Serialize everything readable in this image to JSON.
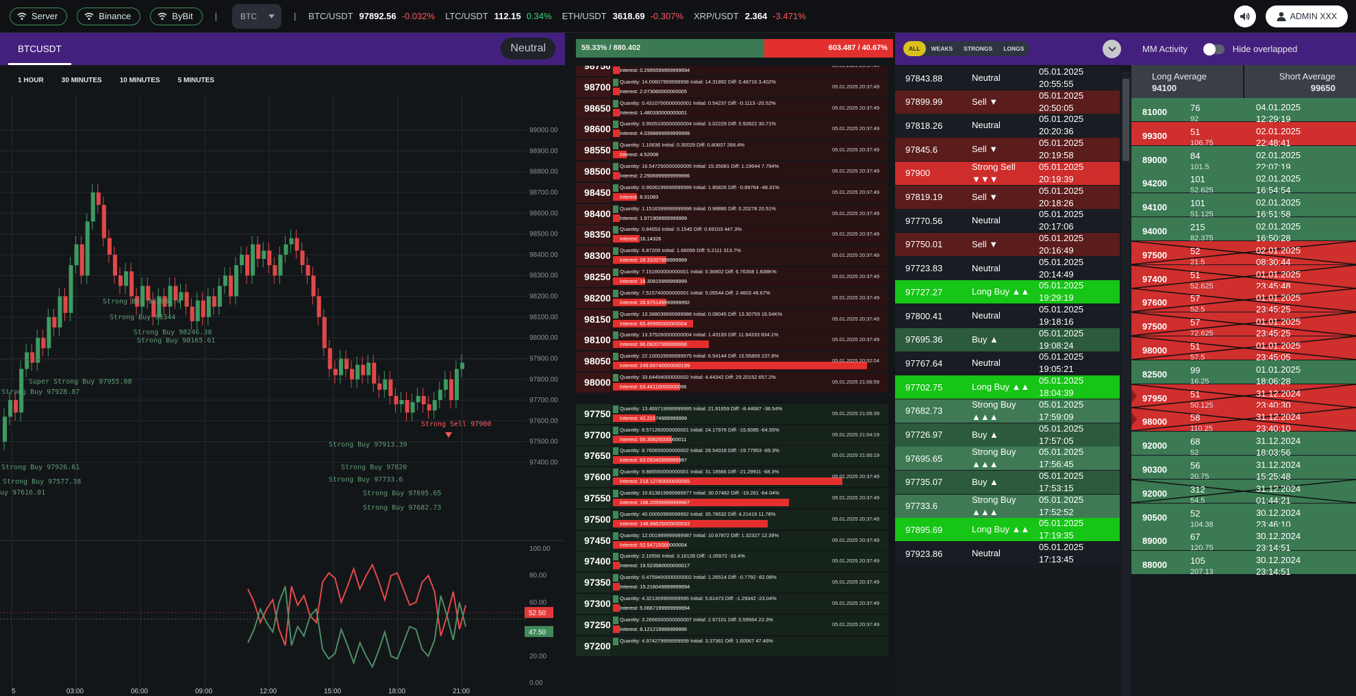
{
  "topbar": {
    "filters": [
      {
        "label": "Server",
        "icon": "wifi-icon"
      },
      {
        "label": "Binance",
        "icon": "wifi-icon"
      },
      {
        "label": "ByBit",
        "icon": "wifi-icon"
      }
    ],
    "separator": "|",
    "coin_select": "BTC",
    "tickers": [
      {
        "symbol": "BTC/USDT",
        "price": "97892.56",
        "change": "-0.032%",
        "dir": "neg"
      },
      {
        "symbol": "LTC/USDT",
        "price": "112.15",
        "change": "0.34%",
        "dir": "pos"
      },
      {
        "symbol": "ETH/USDT",
        "price": "3618.69",
        "change": "-0.307%",
        "dir": "neg"
      },
      {
        "symbol": "XRP/USDT",
        "price": "2.364",
        "change": "-3.471%",
        "dir": "neg"
      }
    ],
    "admin_label": "ADMIN XXX"
  },
  "chart": {
    "symbol_tab": "BTCUSDT",
    "sentiment": "Neutral",
    "timeframes": [
      "1 HOUR",
      "30 MINUTES",
      "10 MINUTES",
      "5 MINUTES"
    ]
  },
  "chart_data": {
    "type": "candlestick",
    "price_axis": [
      "99000.00",
      "98900.00",
      "98800.00",
      "98700.00",
      "98600.00",
      "98500.00",
      "98400.00",
      "98300.00",
      "98200.00",
      "98100.00",
      "98000.00",
      "97900.00",
      "97800.00",
      "97700.00",
      "97600.00",
      "97500.00",
      "97400.00"
    ],
    "ylim": [
      97400,
      99000
    ],
    "x_ticks": [
      "5",
      "03:00",
      "06:00",
      "09:00",
      "12:00",
      "15:00",
      "18:00",
      "21:00"
    ],
    "signal_labels": [
      {
        "text": "Strong Buy 98306.74",
        "type": "buy"
      },
      {
        "text": "Strong Buy 98344",
        "type": "buy"
      },
      {
        "text": "Strong Buy 98246.38",
        "type": "buy"
      },
      {
        "text": "Strong Buy 98165.61",
        "type": "buy"
      },
      {
        "text": "Super Strong Buy 97955.08",
        "type": "buy"
      },
      {
        "text": "Strong Sell 97900",
        "type": "sell"
      },
      {
        "text": "Strong Buy 97913.39",
        "type": "buy"
      },
      {
        "text": "Strong Buy 97820",
        "type": "buy"
      },
      {
        "text": "Strong Buy 97733.6",
        "type": "buy"
      },
      {
        "text": "Strong Buy 97695.65",
        "type": "buy"
      },
      {
        "text": "Strong Buy 97682.73",
        "type": "buy"
      },
      {
        "text": "Strong Buy 97928.87",
        "type": "buy"
      },
      {
        "text": "Strong Buy 97926.61",
        "type": "buy"
      },
      {
        "text": "Strong Buy 97577.38",
        "type": "buy"
      },
      {
        "text": "uy 97616.01",
        "type": "buy"
      }
    ],
    "indicator_axis": [
      "100.00",
      "80.00",
      "60.00",
      "40.00",
      "20.00",
      "0.00"
    ],
    "indicator_ylim": [
      0,
      100
    ],
    "indicator_badges": {
      "red": "52.50",
      "green": "47.50"
    }
  },
  "orderbook": {
    "long_label": "59.33% / 880.402",
    "short_label": "603.487 / 40.67%",
    "long_fraction": 0.5933,
    "asks": [
      {
        "price": "98750",
        "qty": "",
        "interest": "Interest: 0.2995599999999994",
        "time": "05.01.2025 20:37:49"
      },
      {
        "price": "98700",
        "qty": "Quantity: 14.00607999999998 Initial: 14.31892 Diff: 0.48716 3.402%",
        "interest": "Interest: 2.073060000000005",
        "time": "05.01.2025 20:37:49",
        "bar": 0.0
      },
      {
        "price": "98650",
        "qty": "Quantity: 0.4310700000000001 Initial: 0.54237 Diff: -0.1113 -20.52%",
        "interest": "Interest: 1.480330000000001",
        "time": "05.01.2025 20:37:49",
        "bar": 0.0
      },
      {
        "price": "98600",
        "qty": "Quantity: 3.9505100000000004 Initial: 3.02229 Diff: 0.92822 30.71%",
        "interest": "Interest: 4.0398899999999999",
        "time": "05.01.2025 20:37:49",
        "bar": 0.0
      },
      {
        "price": "98550",
        "qty": "Quantity: 1.10636 Initial: 0.30029 Diff: 0.80607 268.4%",
        "interest": "Interest: 4.52008",
        "time": "05.01.2025 20:37:49",
        "bar": 0.05
      },
      {
        "price": "98500",
        "qty": "Quantity: 16.547250000000005 Initial: 15.35081 Diff: 1.19644 7.794%",
        "interest": "Interest: 2.2906999999999996",
        "time": "05.01.2025 20:37:49",
        "bar": 0.0
      },
      {
        "price": "98450",
        "qty": "Quantity: 0.9606199999999999 Initial: 1.85826 Diff: -0.89764 -48.31%",
        "interest": "Interest: 8.31083",
        "time": "05.01.2025 20:37:49",
        "bar": 0.09
      },
      {
        "price": "98400",
        "qty": "Quantity: 1.1516399999999998 Initial: 0.98886 Diff: 0.20278 20.51%",
        "interest": "Interest: 1.971909999999999",
        "time": "05.01.2025 20:37:49",
        "bar": 0.0
      },
      {
        "price": "98350",
        "qty": "Quantity: 0.84553 Initial: 0.1545 Diff: 0.69103 447.3%",
        "interest": "Interest: 16.14326",
        "time": "05.01.2025 20:37:49",
        "bar": 0.1
      },
      {
        "price": "98300",
        "qty": "Quantity: 6.87209 Initial: 1.66099 Diff: 5.2111 313.7%",
        "interest": "Interest: 28.33207999999999",
        "time": "05.01.2025 20:37:49",
        "bar": 0.2
      },
      {
        "price": "98250",
        "qty": "Quantity: 7.151600000000001 Initial: 0.36802 Diff: 6.76358 1.838K%",
        "interest": "Interest: 18.30815999999999",
        "time": "05.01.2025 20:37:49",
        "bar": 0.12
      },
      {
        "price": "98200",
        "qty": "Quantity: 7.515740000000001 Initial: 5.05544 Diff: 2.4603 48.67%",
        "interest": "Interest: 28.975149999999992",
        "time": "05.01.2025 20:37:49",
        "bar": 0.2
      },
      {
        "price": "98150",
        "qty": "Quantity: 13.388039999999988 Initial: 0.08045 Diff: 13.30759 16.54K%",
        "interest": "Interest: 65.49995000000004",
        "time": "05.01.2025 20:37:49",
        "bar": 0.3
      },
      {
        "price": "98100",
        "qty": "Quantity: 13.375260000000004 Initial: 1.43193 Diff: 11.94333 834.1%",
        "interest": "Interest: 96.08207999999998",
        "time": "05.01.2025 20:37:49",
        "bar": 0.36
      },
      {
        "price": "98050",
        "qty": "Quantity: 22.100029999999975 Initial: 6.54144 Diff: 15.55859 237.8%",
        "interest": "Interest: 249.66740000000199",
        "time": "05.01.2025 20:52:04",
        "bar": 0.95
      },
      {
        "price": "98000",
        "qty": "Quantity: 33.64494000000002 Initial: 4.44342 Diff: 29.20152 657.2%",
        "interest": "Interest: 63.44110000000056",
        "time": "05.01.2025 21:06:59",
        "bar": 0.25
      }
    ],
    "bids": [
      {
        "price": "97750",
        "qty": "Quantity: 13.469719999999995 Initial: 21.91659 Diff: -8.44687 -38.54%",
        "interest": "Interest: 42.21574999999999",
        "time": "05.01.2025 21:05:39",
        "bar": 0.16
      },
      {
        "price": "97700",
        "qty": "Quantity: 8.571260000000001 Initial: 24.17976 Diff: -15.6085 -64.55%",
        "interest": "Interest: 56.30825000000011",
        "time": "05.01.2025 21:04:19",
        "bar": 0.22
      },
      {
        "price": "97650",
        "qty": "Quantity: 8.760650000000002 Initial: 28.54018 Diff: -19.77953 -69.3%",
        "interest": "Interest: 63.09340999999997",
        "time": "05.01.2025 21:00:19",
        "bar": 0.25
      },
      {
        "price": "97600",
        "qty": "Quantity: 9.886550000000001 Initial: 31.18566 Diff: -21.29911 -68.3%",
        "interest": "Interest: 218.12760000000065",
        "time": "05.01.2025 20:37:49",
        "bar": 0.86
      },
      {
        "price": "97550",
        "qty": "Quantity: 10.813819999999977 Initial: 30.07482 Diff: -19.261 -64.04%",
        "interest": "Interest: 168.20596999999987",
        "time": "05.01.2025 20:37:49",
        "bar": 0.66
      },
      {
        "price": "97500",
        "qty": "Quantity: 40.00050999999992 Initial: 35.78632 Diff: 4.21419 11.78%",
        "interest": "Interest: 148.98626000000033",
        "time": "05.01.2025 20:37:49",
        "bar": 0.58
      },
      {
        "price": "97450",
        "qty": "Quantity: 12.001989999999987 Initial: 10.67872 Diff: 1.32327 12.39%",
        "interest": "Interest: 52.54715000000004",
        "time": "05.01.2025 20:37:49",
        "bar": 0.21
      },
      {
        "price": "97400",
        "qty": "Quantity: 2.10556 Initial: 3.16128 Diff: -1.05572 -33.4%",
        "interest": "Interest: 19.523580000000017",
        "time": "05.01.2025 20:37:49",
        "bar": 0.0
      },
      {
        "price": "97350",
        "qty": "Quantity: 0.4759400000000002 Initial: 1.26514 Diff: -0.7792 -62.08%",
        "interest": "Interest: 15.216049999999994",
        "time": "05.01.2025 20:37:49",
        "bar": 0.0
      },
      {
        "price": "97300",
        "qty": "Quantity: 4.321309999999995 Initial: 5.61473 Diff: -1.29342 -23.04%",
        "interest": "Interest: 5.0667199999999994",
        "time": "05.01.2025 20:37:49",
        "bar": 0.0
      },
      {
        "price": "97250",
        "qty": "Quantity: 3.2666500000000007 Initial: 2.67101 Diff: 0.59564 22.3%",
        "interest": "Interest: 8.121219999999996",
        "time": "05.01.2025 20:37:49",
        "bar": 0.0
      },
      {
        "price": "97200",
        "qty": "Quantity: 4.974279999999999 Initial: 3.37361 Diff: 1.60067 47.46%",
        "interest": "",
        "time": "",
        "bar": 0.0
      }
    ]
  },
  "signals": {
    "filters": [
      "ALL",
      "WEAKS",
      "STRONGS",
      "LONGS"
    ],
    "rows": [
      {
        "price": "97843.88",
        "signal": "Neutral",
        "date": "05.01.2025",
        "time": "20:55:55",
        "kind": "neutral"
      },
      {
        "price": "97899.99",
        "signal": "Sell ▼",
        "date": "05.01.2025",
        "time": "20:50:05",
        "kind": "sell"
      },
      {
        "price": "97818.26",
        "signal": "Neutral",
        "date": "05.01.2025",
        "time": "20:20:36",
        "kind": "neutral"
      },
      {
        "price": "97845.6",
        "signal": "Sell ▼",
        "date": "05.01.2025",
        "time": "20:19:58",
        "kind": "sell"
      },
      {
        "price": "97900",
        "signal": "Strong Sell ▼▼▼",
        "date": "05.01.2025",
        "time": "20:19:39",
        "kind": "strongsell"
      },
      {
        "price": "97819.19",
        "signal": "Sell ▼",
        "date": "05.01.2025",
        "time": "20:18:26",
        "kind": "sell"
      },
      {
        "price": "97770.56",
        "signal": "Neutral",
        "date": "05.01.2025",
        "time": "20:17:06",
        "kind": "neutral"
      },
      {
        "price": "97750.01",
        "signal": "Sell ▼",
        "date": "05.01.2025",
        "time": "20:16:49",
        "kind": "sell"
      },
      {
        "price": "97723.83",
        "signal": "Neutral",
        "date": "05.01.2025",
        "time": "20:14:49",
        "kind": "neutral"
      },
      {
        "price": "97727.27",
        "signal": "Long Buy ▲▲",
        "date": "05.01.2025",
        "time": "19:29:19",
        "kind": "long"
      },
      {
        "price": "97800.41",
        "signal": "Neutral",
        "date": "05.01.2025",
        "time": "19:18:16",
        "kind": "neutral"
      },
      {
        "price": "97695.36",
        "signal": "Buy ▲",
        "date": "05.01.2025",
        "time": "19:08:24",
        "kind": "buy"
      },
      {
        "price": "97767.64",
        "signal": "Neutral",
        "date": "05.01.2025",
        "time": "19:05:21",
        "kind": "neutral"
      },
      {
        "price": "97702.75",
        "signal": "Long Buy ▲▲",
        "date": "05.01.2025",
        "time": "18:04:39",
        "kind": "long"
      },
      {
        "price": "97682.73",
        "signal": "Strong Buy ▲▲▲",
        "date": "05.01.2025",
        "time": "17:59:09",
        "kind": "strongbuy"
      },
      {
        "price": "97726.97",
        "signal": "Buy ▲",
        "date": "05.01.2025",
        "time": "17:57:05",
        "kind": "buy"
      },
      {
        "price": "97695.65",
        "signal": "Strong Buy ▲▲▲",
        "date": "05.01.2025",
        "time": "17:56:45",
        "kind": "strongbuy"
      },
      {
        "price": "97735.07",
        "signal": "Buy ▲",
        "date": "05.01.2025",
        "time": "17:53:15",
        "kind": "buy"
      },
      {
        "price": "97733.6",
        "signal": "Strong Buy ▲▲▲",
        "date": "05.01.2025",
        "time": "17:52:52",
        "kind": "strongbuy"
      },
      {
        "price": "97895.69",
        "signal": "Long Buy ▲▲",
        "date": "05.01.2025",
        "time": "17:19:35",
        "kind": "long"
      },
      {
        "price": "97923.86",
        "signal": "Neutral",
        "date": "05.01.2025",
        "time": "17:13:45",
        "kind": "neutral"
      }
    ]
  },
  "mm": {
    "title": "MM Activity",
    "hide_label": "Hide overlapped",
    "long_avg_label": "Long Average",
    "long_avg_value": "94100",
    "short_avg_label": "Short Average",
    "short_avg_value": "99650",
    "rows": [
      {
        "price": "81000",
        "n": "76",
        "m": "92",
        "date": "04.01.2025",
        "time": "12:29:19",
        "kind": "long",
        "crossed": false,
        "marker": false
      },
      {
        "price": "99300",
        "n": "51",
        "m": "106.75",
        "date": "02.01.2025",
        "time": "22:48:41",
        "kind": "short",
        "crossed": false,
        "marker": false
      },
      {
        "price": "89000",
        "n": "84",
        "m": "101.5",
        "date": "02.01.2025",
        "time": "22:07:19",
        "kind": "long",
        "crossed": false,
        "marker": false
      },
      {
        "price": "94200",
        "n": "101",
        "m": "52.625",
        "date": "02.01.2025",
        "time": "16:54:54",
        "kind": "long",
        "crossed": false,
        "marker": false
      },
      {
        "price": "94100",
        "n": "101",
        "m": "51.125",
        "date": "02.01.2025",
        "time": "16:51:58",
        "kind": "long",
        "crossed": false,
        "marker": false
      },
      {
        "price": "94000",
        "n": "215",
        "m": "82.375",
        "date": "02.01.2025",
        "time": "16:50:28",
        "kind": "long",
        "crossed": false,
        "marker": false
      },
      {
        "price": "97500",
        "n": "52",
        "m": "21.5",
        "date": "02.01.2025",
        "time": "08:30:44",
        "kind": "short",
        "crossed": true,
        "marker": false
      },
      {
        "price": "97400",
        "n": "51",
        "m": "52.625",
        "date": "01.01.2025",
        "time": "23:45:48",
        "kind": "short",
        "crossed": true,
        "marker": false
      },
      {
        "price": "97600",
        "n": "57",
        "m": "52.5",
        "date": "01.01.2025",
        "time": "23:45:25",
        "kind": "short",
        "crossed": true,
        "marker": false
      },
      {
        "price": "97500",
        "n": "57",
        "m": "72.625",
        "date": "01.01.2025",
        "time": "23:45:25",
        "kind": "short",
        "crossed": true,
        "marker": false
      },
      {
        "price": "98000",
        "n": "51",
        "m": "57.5",
        "date": "01.01.2025",
        "time": "23:45:05",
        "kind": "short",
        "crossed": true,
        "marker": false
      },
      {
        "price": "82500",
        "n": "99",
        "m": "16.25",
        "date": "01.01.2025",
        "time": "18:06:28",
        "kind": "long",
        "crossed": false,
        "marker": false
      },
      {
        "price": "97950",
        "n": "51",
        "m": "50.125",
        "date": "31.12.2024",
        "time": "23:40:30",
        "kind": "short",
        "crossed": true,
        "marker": true
      },
      {
        "price": "98000",
        "n": "58",
        "m": "110.25",
        "date": "31.12.2024",
        "time": "23:40:10",
        "kind": "short",
        "crossed": true,
        "marker": true
      },
      {
        "price": "92000",
        "n": "68",
        "m": "52",
        "date": "31.12.2024",
        "time": "18:03:56",
        "kind": "long",
        "crossed": false,
        "marker": false
      },
      {
        "price": "90300",
        "n": "56",
        "m": "20.75",
        "date": "31.12.2024",
        "time": "15:25:48",
        "kind": "long",
        "crossed": false,
        "marker": false
      },
      {
        "price": "92000",
        "n": "312",
        "m": "54.5",
        "date": "31.12.2024",
        "time": "01:44:21",
        "kind": "long",
        "crossed": true,
        "marker": false
      },
      {
        "price": "90500",
        "n": "52",
        "m": "104.38",
        "date": "30.12.2024",
        "time": "23:46:10",
        "kind": "long",
        "crossed": false,
        "marker": false
      },
      {
        "price": "89000",
        "n": "67",
        "m": "120.75",
        "date": "30.12.2024",
        "time": "23:14:51",
        "kind": "long",
        "crossed": false,
        "marker": false
      },
      {
        "price": "88000",
        "n": "105",
        "m": "207.13",
        "date": "30.12.2024",
        "time": "23:14:51",
        "kind": "long",
        "crossed": false,
        "marker": false
      }
    ]
  },
  "colors": {
    "header_purple": "#44207e",
    "long_green": "#3b7a53",
    "short_red": "#e3302e",
    "bright_green": "#16c516"
  }
}
